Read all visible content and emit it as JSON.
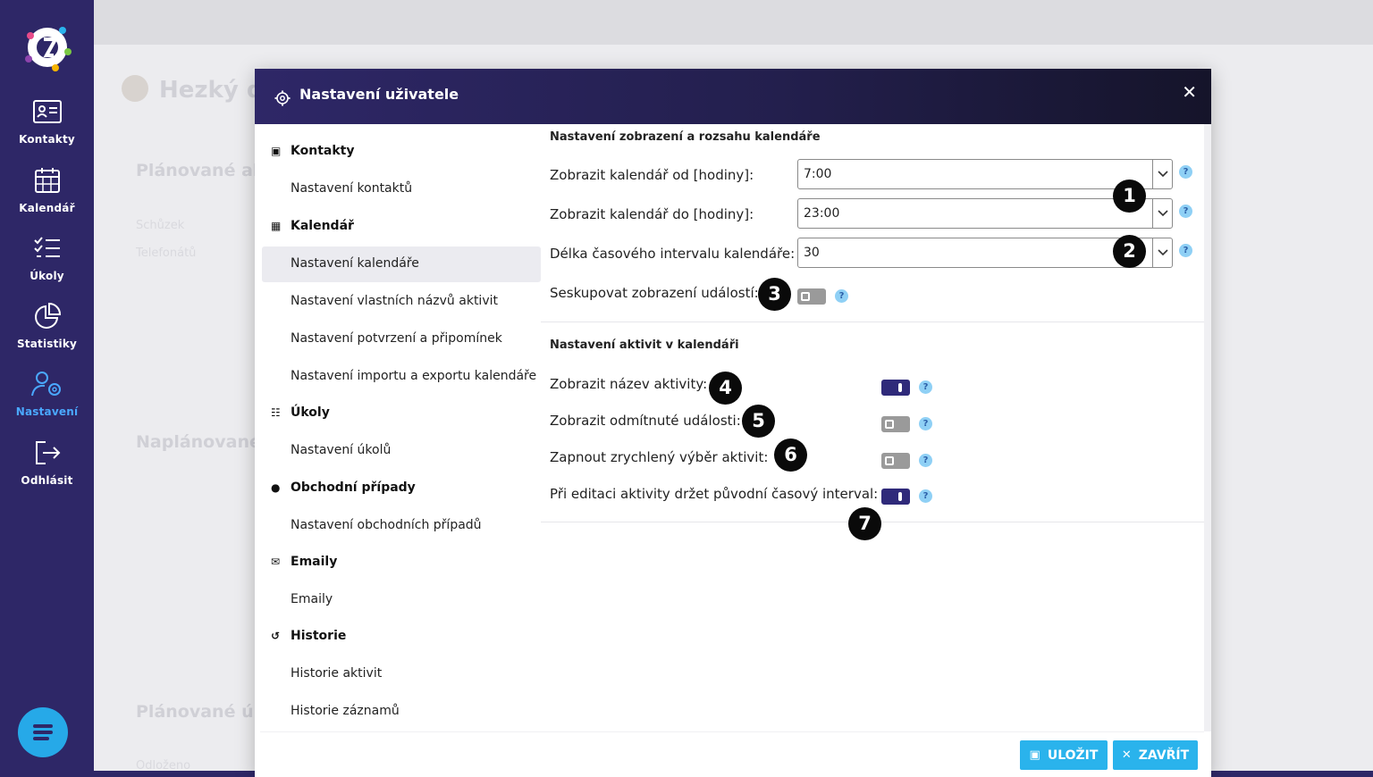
{
  "sidebar": {
    "items": [
      {
        "label": "Kontakty",
        "icon": "contact-card-icon"
      },
      {
        "label": "Kalendář",
        "icon": "calendar-icon"
      },
      {
        "label": "Úkoly",
        "icon": "checklist-icon"
      },
      {
        "label": "Statistiky",
        "icon": "pie-chart-icon"
      },
      {
        "label": "Nastavení",
        "icon": "user-settings-icon",
        "active": true
      },
      {
        "label": "Odhlásit",
        "icon": "logout-icon"
      }
    ]
  },
  "background": {
    "header_title": "Hezký de",
    "sections": [
      "Plánované ak",
      "Naplánované",
      "Plánované úk"
    ],
    "small_items": [
      "Schůzek",
      "Telefonátů",
      "Odloženo"
    ]
  },
  "modal": {
    "title": "Nastavení uživatele",
    "menu": {
      "groups": [
        {
          "label": "Kontakty",
          "icon": "contact-book-icon",
          "items": [
            "Nastavení kontaktů"
          ]
        },
        {
          "label": "Kalendář",
          "icon": "calendar-icon",
          "items": [
            "Nastavení kalendáře",
            "Nastavení vlastních názvů aktivit",
            "Nastavení potvrzení a připomínek",
            "Nastavení importu a exportu kalendáře"
          ]
        },
        {
          "label": "Úkoly",
          "icon": "list-icon",
          "items": [
            "Nastavení úkolů"
          ]
        },
        {
          "label": "Obchodní případy",
          "icon": "money-bag-icon",
          "items": [
            "Nastavení obchodních případů"
          ]
        },
        {
          "label": "Emaily",
          "icon": "envelope-icon",
          "items": [
            "Emaily"
          ]
        },
        {
          "label": "Historie",
          "icon": "history-icon",
          "items": [
            "Historie aktivit",
            "Historie záznamů"
          ]
        }
      ],
      "active_item": "Nastavení kalendáře"
    },
    "section1": {
      "title": "Nastavení zobrazení a rozsahu kalendáře",
      "fields": [
        {
          "label": "Zobrazit kalendář od [hodiny]:",
          "value": "7:00"
        },
        {
          "label": "Zobrazit kalendář do [hodiny]:",
          "value": "23:00"
        },
        {
          "label": "Délka časového intervalu kalendáře:",
          "value": "30"
        }
      ],
      "toggle": {
        "label": "Seskupovat zobrazení událostí:",
        "on": false
      }
    },
    "section2": {
      "title": "Nastavení aktivit v kalendáři",
      "toggles": [
        {
          "label": "Zobrazit název aktivity:",
          "on": true
        },
        {
          "label": "Zobrazit odmítnuté události:",
          "on": false
        },
        {
          "label": "Zapnout zrychlený výběr aktivit:",
          "on": false
        },
        {
          "label": "Při editaci aktivity držet původní časový interval:",
          "on": true
        }
      ]
    },
    "help_symbol": "?",
    "badges": [
      "1",
      "2",
      "3",
      "4",
      "5",
      "6",
      "7"
    ],
    "buttons": {
      "save": "ULOŽIT",
      "close": "ZAVŘÍT"
    }
  },
  "colors": {
    "sidebar": "#2e2767",
    "accent": "#2ab3ec",
    "toggle_on": "#2f2a7a",
    "active_nav": "#4aa8ff"
  }
}
